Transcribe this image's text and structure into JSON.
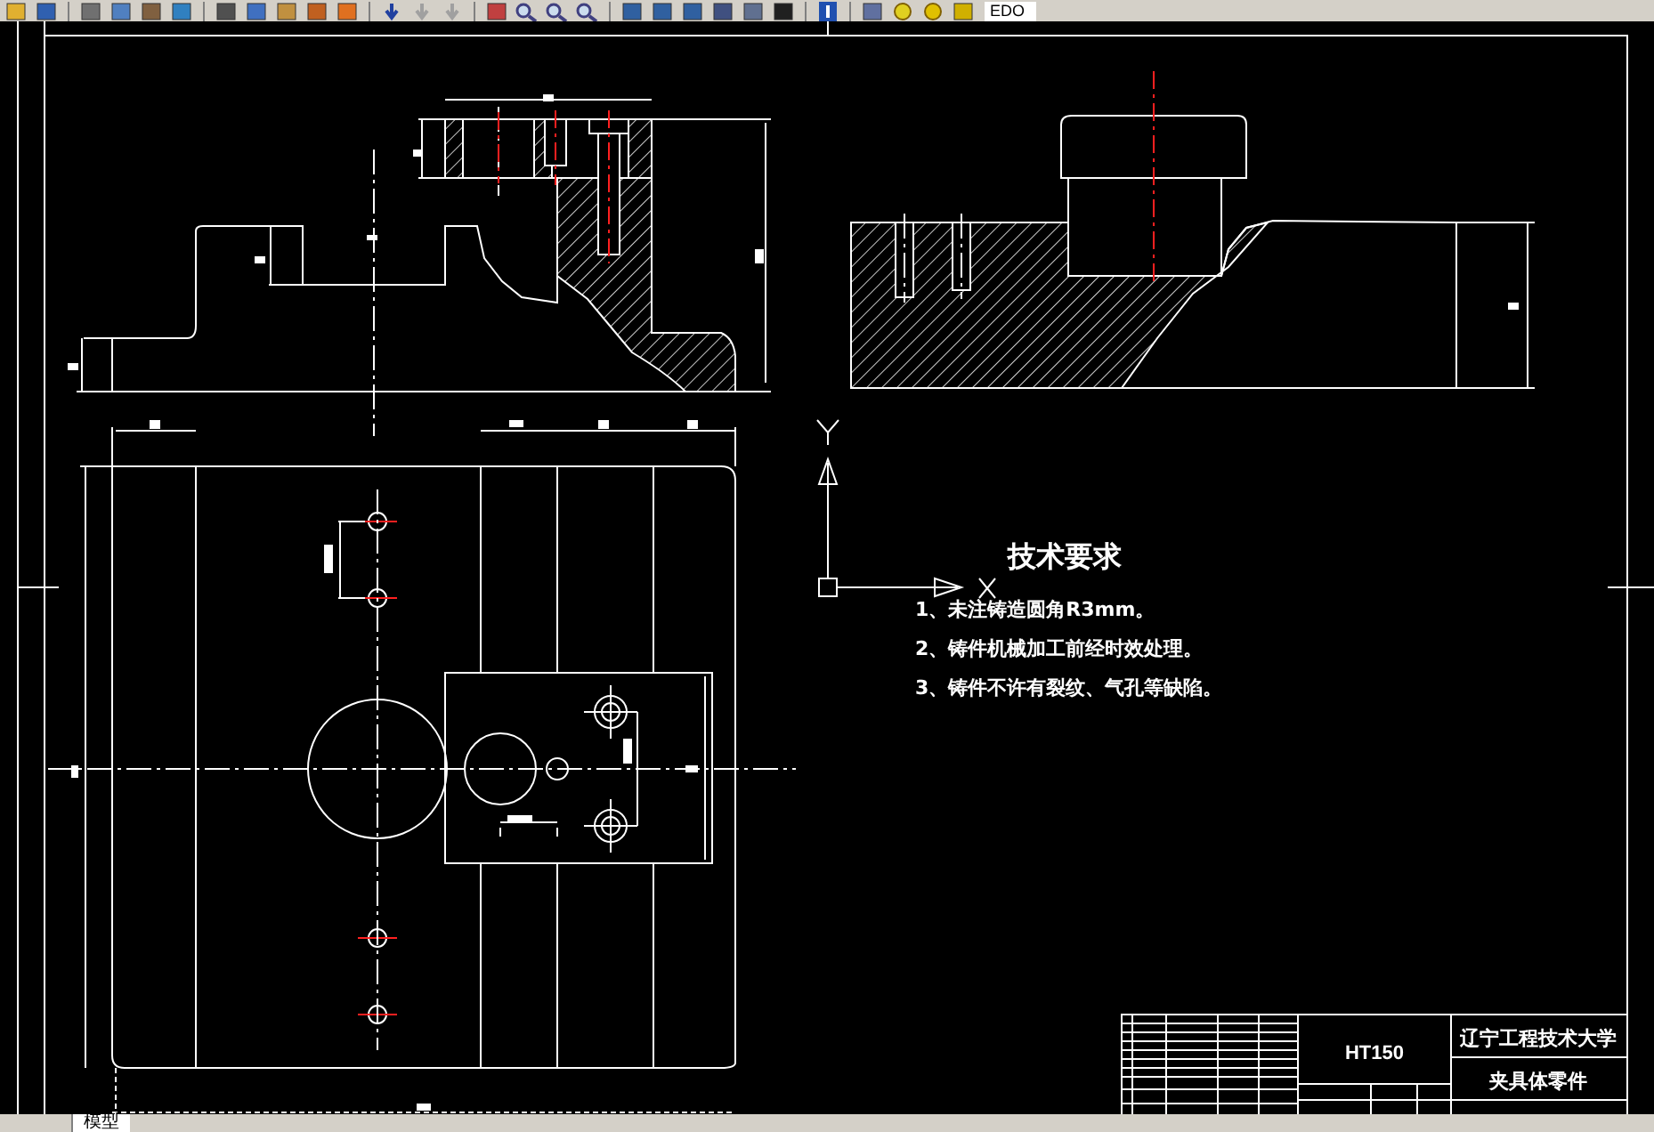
{
  "toolbar": {
    "layer_field": "EDO"
  },
  "drawing": {
    "notes": {
      "title": "技术要求",
      "items": [
        "1、未注铸造圆角R3mm。",
        "2、铸件机械加工前经时效处理。",
        "3、铸件不许有裂纹、气孔等缺陷。"
      ]
    },
    "title_block": {
      "material": "HT150",
      "school": "辽宁工程技术大学",
      "part_name": "夹具体零件"
    }
  },
  "model_tab": {
    "label": "模型",
    "selected": true
  }
}
